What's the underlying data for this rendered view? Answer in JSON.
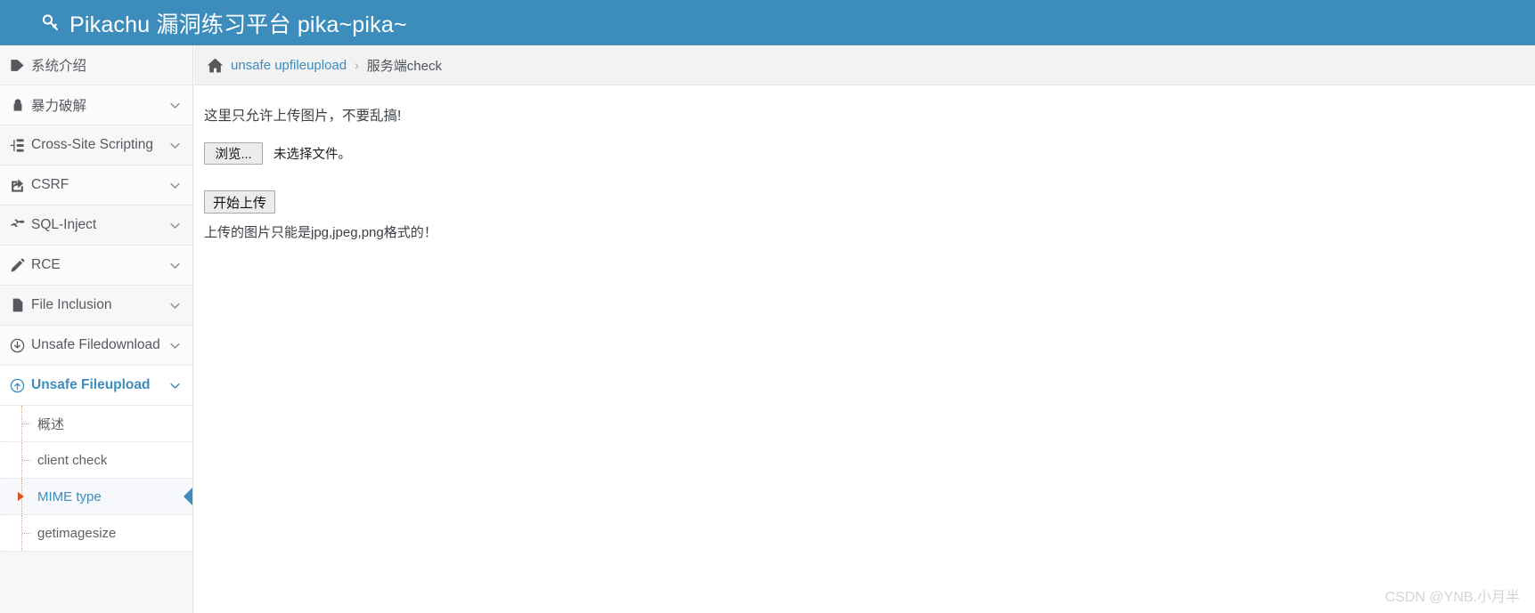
{
  "header": {
    "title": "Pikachu 漏洞练习平台 pika~pika~",
    "logo_icon": "search-key-icon",
    "background_color": "#3c8dbc"
  },
  "sidebar": {
    "background_color": "#f7f7f7",
    "active_color": "#3c8dbc",
    "items": [
      {
        "label": "系统介绍",
        "icon": "tag-icon",
        "has_caret": false,
        "active": false
      },
      {
        "label": "暴力破解",
        "icon": "lock-icon",
        "has_caret": true,
        "active": false
      },
      {
        "label": "Cross-Site Scripting",
        "icon": "sitemap-icon",
        "has_caret": true,
        "active": false
      },
      {
        "label": "CSRF",
        "icon": "share-square-icon",
        "has_caret": true,
        "active": false
      },
      {
        "label": "SQL-Inject",
        "icon": "plane-icon",
        "has_caret": true,
        "active": false
      },
      {
        "label": "RCE",
        "icon": "pencil-icon",
        "has_caret": true,
        "active": false
      },
      {
        "label": "File Inclusion",
        "icon": "file-icon",
        "has_caret": true,
        "active": false
      },
      {
        "label": "Unsafe Filedownload",
        "icon": "arrow-circle-down-icon",
        "has_caret": true,
        "active": false
      },
      {
        "label": "Unsafe Fileupload",
        "icon": "arrow-circle-up-icon",
        "has_caret": true,
        "active": true
      }
    ],
    "sub_items": [
      {
        "label": "概述",
        "selected": false
      },
      {
        "label": "client check",
        "selected": false
      },
      {
        "label": "MIME type",
        "selected": true
      },
      {
        "label": "getimagesize",
        "selected": false
      }
    ]
  },
  "breadcrumb": {
    "home_icon": "home-icon",
    "link_label": "unsafe upfileupload",
    "separator": "›",
    "current_label": "服务端check"
  },
  "content": {
    "lead_text": "这里只允许上传图片，不要乱搞!",
    "browse_button_label": "浏览...",
    "file_status_text": "未选择文件。",
    "submit_button_label": "开始上传",
    "hint_text": "上传的图片只能是jpg,jpeg,png格式的！"
  },
  "watermark": {
    "text": "CSDN @YNB.小月半"
  }
}
